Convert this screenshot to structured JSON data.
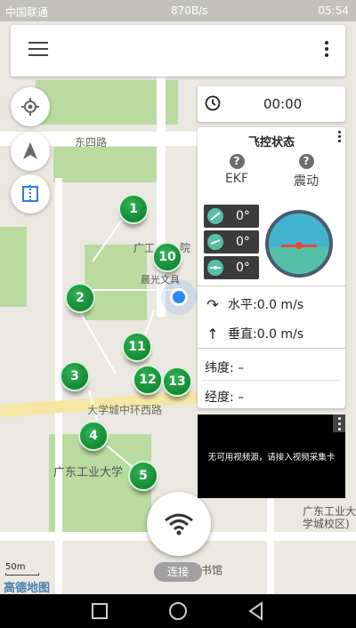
{
  "status_bar": {
    "carrier": "中国联通",
    "speed": "870B/s",
    "time": "05:54"
  },
  "toolbar": {
    "menu_icon": "hamburger-menu-icon",
    "more_icon": "more-vertical-icon"
  },
  "timer": {
    "icon": "clock-icon",
    "value": "00:00"
  },
  "flight_panel": {
    "title": "飞控状态",
    "ekf_label": "EKF",
    "vibration_label": "震动",
    "roll": "0°",
    "pitch": "0°",
    "yaw": "0°",
    "horizontal_speed": "水平:0.0 m/s",
    "vertical_speed": "垂直:0.0 m/s",
    "latitude": "纬度: –",
    "longitude": "经度: –"
  },
  "video": {
    "message": "无可用视频源，请接入视频采集卡"
  },
  "connect": {
    "label": "连接"
  },
  "map": {
    "labels": {
      "road1": "东四路",
      "poi1": "广工",
      "poi1b": "院",
      "poi2": "晨光文具",
      "road2": "大学城中环西路",
      "campus": "广东工业大学",
      "poi3": "广东工业大",
      "poi3b": "学城校区)",
      "library": "图书馆",
      "scale": "50m",
      "logo": "高德地图"
    },
    "waypoints": [
      "1",
      "2",
      "3",
      "4",
      "5",
      "10",
      "11",
      "12",
      "13"
    ]
  },
  "colors": {
    "waypoint": "#1e9b44",
    "accent": "#2f88f0"
  }
}
